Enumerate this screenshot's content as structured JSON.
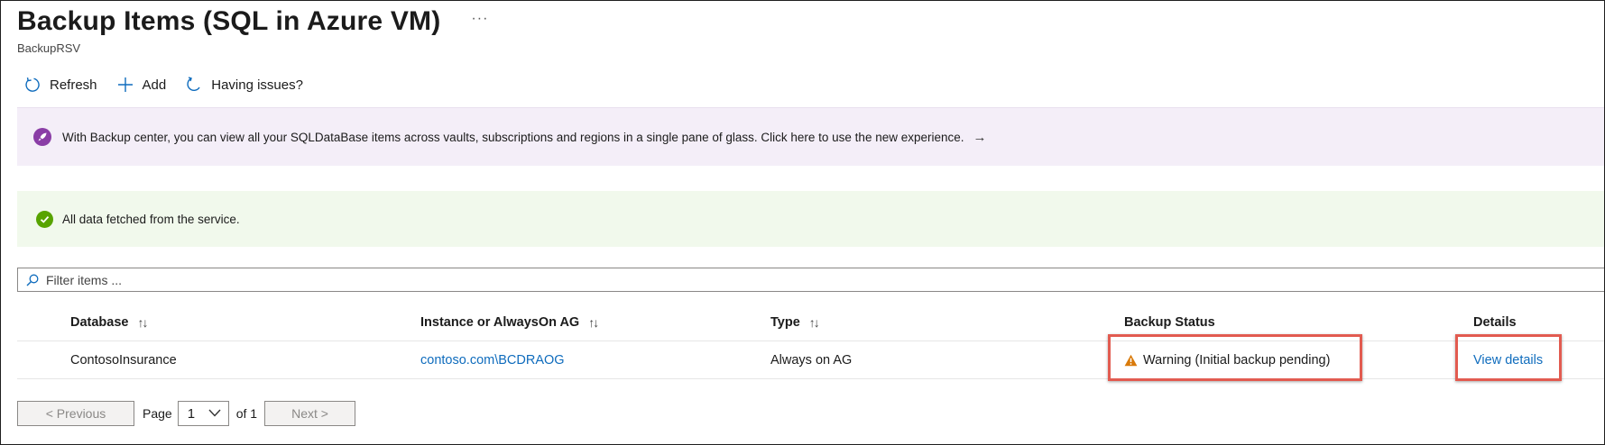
{
  "header": {
    "title": "Backup Items (SQL in Azure VM)",
    "more_glyph": "···",
    "subtitle": "BackupRSV"
  },
  "toolbar": {
    "refresh": {
      "label": "Refresh",
      "icon": "refresh-icon"
    },
    "add": {
      "label": "Add",
      "icon": "plus-icon"
    },
    "issues": {
      "label": "Having issues?",
      "icon": "feedback-icon"
    }
  },
  "promo_banner": {
    "text": "With Backup center, you can view all your SQLDataBase items across vaults, subscriptions and regions in a single pane of glass. Click here to use the new experience.",
    "arrow": "→",
    "icon": "rocket-icon",
    "color": "#8a3da6"
  },
  "status_banner": {
    "text": "All data fetched from the service.",
    "icon": "check-circle-icon",
    "color": "#57a300"
  },
  "filter": {
    "placeholder": "Filter items ..."
  },
  "table": {
    "columns": [
      {
        "label": "Database",
        "sortable": true
      },
      {
        "label": "Instance or AlwaysOn AG",
        "sortable": true
      },
      {
        "label": "Type",
        "sortable": true
      },
      {
        "label": "Backup Status",
        "sortable": false
      },
      {
        "label": "Details",
        "sortable": false
      }
    ],
    "sort_glyph": "↑↓",
    "rows": [
      {
        "database": "ContosoInsurance",
        "instance": "contoso.com\\BCDRAOG",
        "type": "Always on AG",
        "status": "Warning (Initial backup pending)",
        "details": "View details"
      }
    ]
  },
  "pager": {
    "previous": "< Previous",
    "page_label": "Page",
    "page_value": "1",
    "of_label": "of 1",
    "next": "Next >"
  },
  "colors": {
    "link": "#0f6cbd",
    "highlight": "#e25b50",
    "warning": "#d97a0a"
  }
}
